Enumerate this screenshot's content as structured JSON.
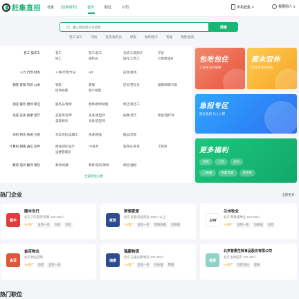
{
  "header": {
    "logo_text": "赶集直招",
    "city": "北京",
    "city_switch": "[切换城市]",
    "nav": [
      "首页",
      "职位",
      "公司"
    ],
    "active_nav": "首页",
    "right_links": [
      "手机赶集 ∨",
      "我要招人 ∨"
    ]
  },
  "search": {
    "placeholder": "输入职位或公司名称",
    "button_label": "搜索",
    "hot_words": [
      "普工/技工",
      "司机",
      "饭店/服务员",
      "保安",
      "厨师/厨工",
      "客服",
      "销售/招商"
    ]
  },
  "categories": [
    {
      "title": "普工 操作工",
      "items": [
        "普工",
        "普工/技工",
        "包装工/装卸工",
        "学徒"
      ],
      "sub": [
        "技工",
        "质检员",
        "操作工/普工",
        "仓库管理员"
      ]
    },
    {
      "title": "人力 行政 财务",
      "items": [
        "人事/行政/文员",
        "HR",
        "前台/接待",
        ""
      ],
      "sub": []
    },
    {
      "title": "销售 客服 市场 公关",
      "items": [
        "销售",
        "客服",
        "店员/营业员",
        "推销/销售代表"
      ],
      "sub": [
        "招商经理",
        "客户经理",
        "",
        ""
      ]
    },
    {
      "title": "酒店 餐饮 厨师 保洁",
      "items": [
        "服务员/接待",
        "厨师/厨师助理",
        "保洁/清洁工",
        ""
      ],
      "sub": []
    },
    {
      "title": "美容 美发 按摩 足疗",
      "items": [
        "美容师/美甲",
        "美发/发型师",
        "按摩/足疗",
        "养生/理疗师"
      ],
      "sub": [
        "美容顾问",
        "化妆/造型师",
        "",
        ""
      ]
    },
    {
      "title": "司机 物流 快递 仓管",
      "items": [
        "货车司机/运输工",
        "快递/配送",
        "搬运/装卸",
        ""
      ],
      "sub": [
        "仓库管理员",
        "",
        "",
        ""
      ]
    },
    {
      "title": "计算机 网络 通信 软件",
      "items": [
        "网站/网页设计",
        "IT/技术",
        "程序员/开发",
        "工程师"
      ],
      "sub": [
        "运维管理员",
        "",
        "",
        ""
      ]
    },
    {
      "title": "教育 培训 翻译 保险",
      "items": [
        "教师/助教",
        "教育/培训/讲师",
        "保险/理财",
        ""
      ],
      "sub": []
    }
  ],
  "category_more": "全部职位分类",
  "banners": [
    {
      "title": "包吃包住",
      "desc": "工作生活有保障"
    },
    {
      "title": "周末双休",
      "desc": "享受生活好时光"
    },
    {
      "title": "急招专区",
      "desc": "岗位急招 马上入职"
    },
    {
      "title": "更多福利",
      "pills": [
        "包吃",
        "二险",
        "五险",
        "二休假",
        "带薪年假",
        "年终奖"
      ]
    }
  ],
  "hot_companies": {
    "title": "热门企业",
    "more": "全部更多 ›",
    "items": [
      {
        "name": "顺丰车行",
        "logo_text": "顺丰",
        "logo_color": "#e23b3b",
        "meta": "北京 汽车租赁/销售 100-499人",
        "tags": [
          "VR看厂",
          "五险一金",
          "包住",
          "包吃"
        ]
      },
      {
        "name": "梦想家居",
        "logo_text": "家居",
        "logo_color": "#2d4c8f",
        "meta": "北京 家具/家居用品 1000人以上",
        "tags": [
          "VR看厂",
          "五险一金",
          "带薪休假",
          "包住宿"
        ]
      },
      {
        "name": "兰州牧业",
        "logo_text": "兰州",
        "logo_color": "#ffffff",
        "meta": "北京 养殖/畜牧业 100-499人",
        "tags": [
          "VR看厂",
          "五险一金",
          "包住宿",
          "包吃"
        ]
      },
      {
        "name": "金百物业",
        "logo_text": "金百",
        "logo_color": "#e0563b",
        "meta": "北京 物业管理",
        "tags": [
          "VR看厂",
          "包吃",
          "五险一金"
        ]
      },
      {
        "name": "瑞康物流",
        "logo_text": "瑞康",
        "logo_color": "#2d4c8f",
        "meta": "北京 交通运输/物流 100-499人",
        "tags": [
          "VR看厂",
          "五险一金",
          "包住宿",
          "带薪"
        ]
      },
      {
        "name": "北京普惠生鲜食品股份有限公司",
        "logo_text": "普惠",
        "logo_color": "#8fd3c7",
        "meta": "北京 生鲜超市 100-499人",
        "tags": [
          "VR看厂",
          "包吃包住",
          "双休"
        ]
      }
    ]
  },
  "hot_jobs_title": "热门职位",
  "colors": {
    "brand": "#1bb574",
    "accent": "#f5a524"
  }
}
